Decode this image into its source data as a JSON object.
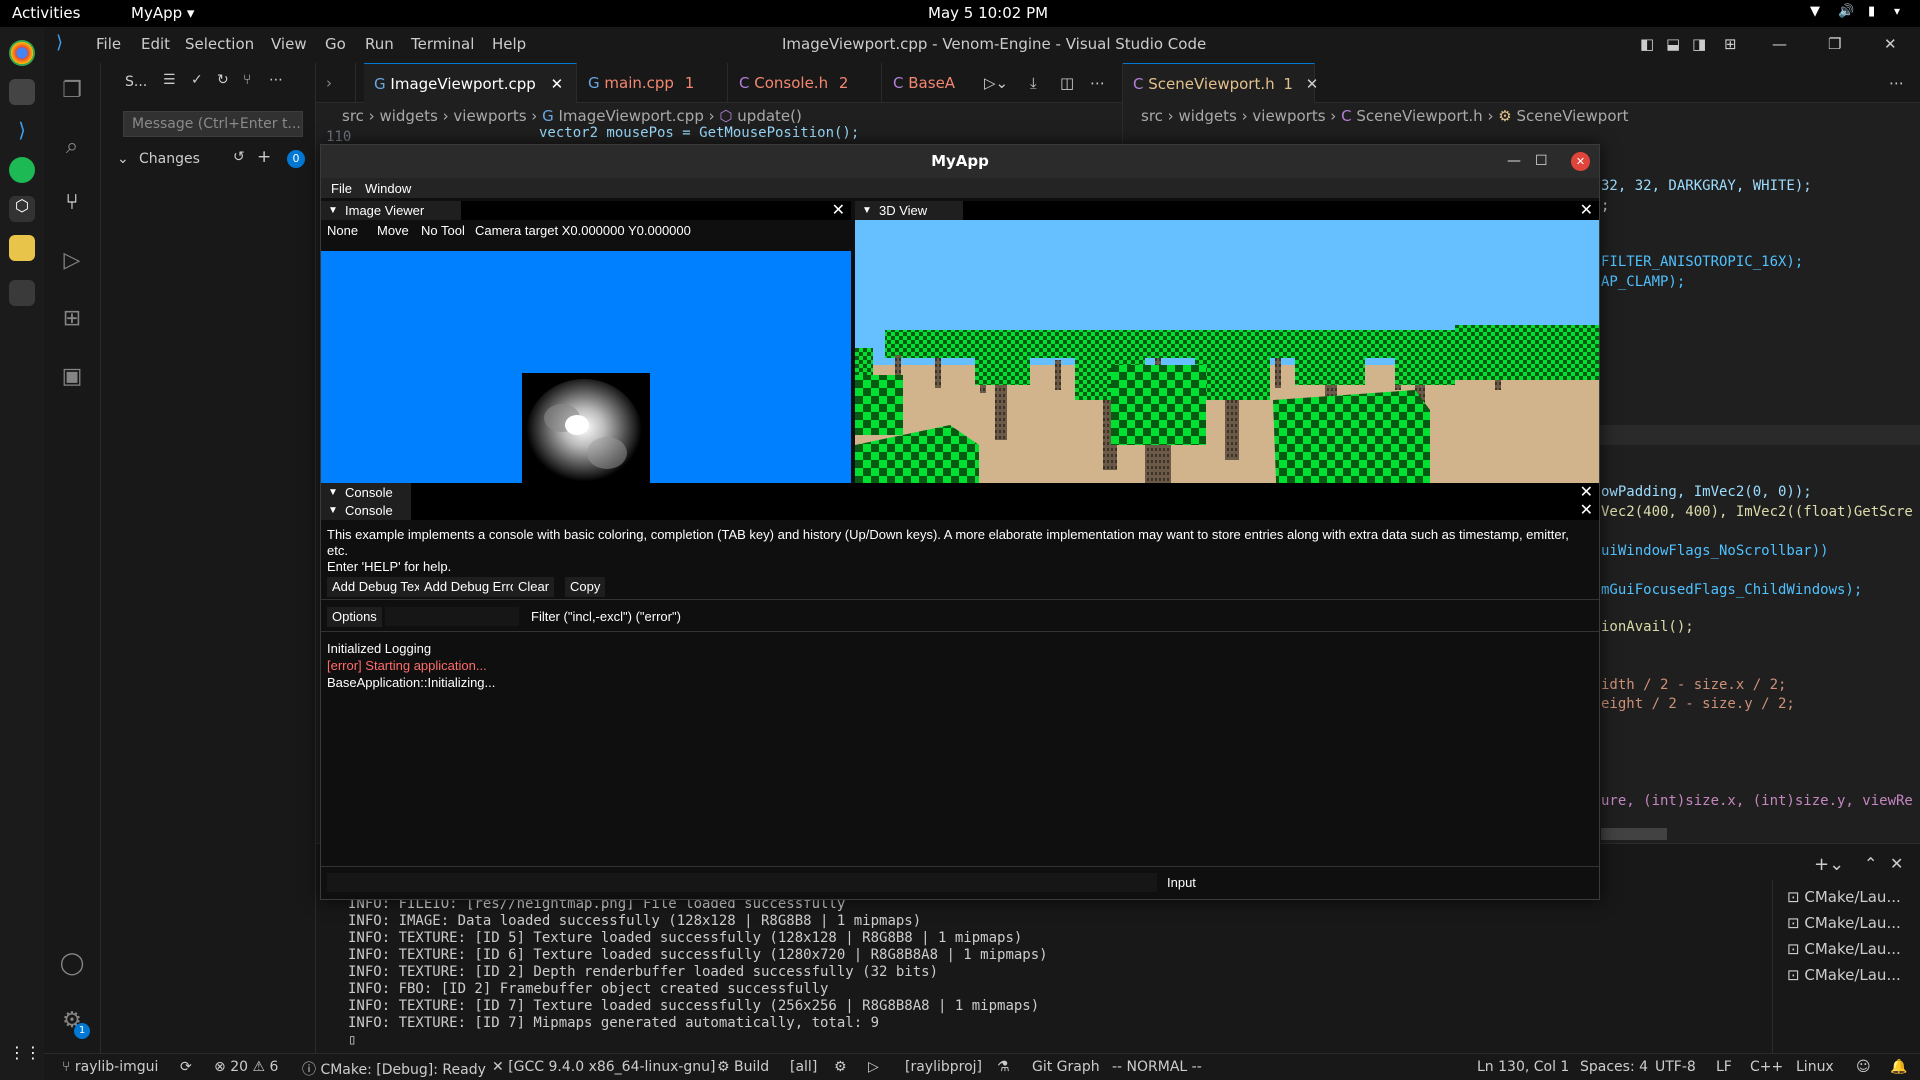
{
  "topbar": {
    "activities": "Activities",
    "app": "MyApp",
    "datetime": "May 5  10:02 PM"
  },
  "vscode": {
    "menu": [
      "File",
      "Edit",
      "Selection",
      "View",
      "Go",
      "Run",
      "Terminal",
      "Help"
    ],
    "title": "ImageViewport.cpp - Venom-Engine - Visual Studio Code",
    "sidebar": {
      "header": "S...",
      "message_placeholder": "Message (Ctrl+Enter t...",
      "changes_label": "Changes",
      "changes_count": "0"
    },
    "tabs_left": [
      {
        "label": "ImageViewport.cpp",
        "badge": "",
        "icon": "G"
      },
      {
        "label": "main.cpp",
        "badge": "1",
        "icon": "G"
      },
      {
        "label": "Console.h",
        "badge": "2",
        "icon": "C"
      },
      {
        "label": "BaseA",
        "badge": "",
        "icon": "C"
      }
    ],
    "tabs_right": [
      {
        "label": "SceneViewport.h",
        "badge": "1",
        "icon": "C"
      }
    ],
    "breadcrumb_left": [
      "src",
      "widgets",
      "viewports",
      "ImageViewport.cpp",
      "update()"
    ],
    "breadcrumb_right": [
      "src",
      "widgets",
      "viewports",
      "SceneViewport.h",
      "SceneViewport"
    ],
    "code_left_partial": "vector2 mousePos = GetMousePosition();",
    "line_no": "110",
    "code_right": [
      "32, 32, DARKGRAY, WHITE);",
      ";",
      "FILTER_ANISOTROPIC_16X);",
      "AP_CLAMP);",
      "owPadding, ImVec2(0, 0));",
      "Vec2(400, 400), ImVec2((float)GetScre",
      "uiWindowFlags_NoScrollbar))",
      "mGuiFocusedFlags_ChildWindows);",
      "ionAvail();",
      "idth / 2 - size.x / 2;",
      "eight / 2 - size.y / 2;",
      "ure, (int)size.x, (int)size.y, viewRe"
    ],
    "terminal_lines": [
      "INFO: FILEIO: [res//heightmap.png] File loaded successfully",
      "INFO: IMAGE: Data loaded successfully (128x128 | R8G8B8 | 1 mipmaps)",
      "INFO: TEXTURE: [ID 5] Texture loaded successfully (128x128 | R8G8B8 | 1 mipmaps)",
      "INFO: TEXTURE: [ID 6] Texture loaded successfully (1280x720 | R8G8B8A8 | 1 mipmaps)",
      "INFO: TEXTURE: [ID 2] Depth renderbuffer loaded successfully (32 bits)",
      "INFO: FBO: [ID 2] Framebuffer object created successfully",
      "INFO: TEXTURE: [ID 7] Texture loaded successfully (256x256 | R8G8B8A8 | 1 mipmaps)",
      "INFO: TEXTURE: [ID 7] Mipmaps generated automatically, total: 9"
    ],
    "terminal_list": [
      "CMake/Lau...",
      "CMake/Lau...",
      "CMake/Lau...",
      "CMake/Lau..."
    ],
    "status": {
      "branch": "raylib-imgui",
      "errors": "20",
      "warnings": "6",
      "cmake": "CMake: [Debug]: Ready",
      "compiler": "[GCC 9.4.0 x86_64-linux-gnu]",
      "build": "Build",
      "target": "[all]",
      "project": "[raylibproj]",
      "gitgraph": "Git Graph",
      "mode": "-- NORMAL --",
      "position": "Ln 130, Col 1",
      "spaces": "Spaces: 4",
      "encoding": "UTF-8",
      "eol": "LF",
      "language": "C++",
      "os": "Linux",
      "settings_badge": "1"
    }
  },
  "myapp": {
    "title": "MyApp",
    "menu": [
      "File",
      "Window"
    ],
    "image_viewer": {
      "tab": "Image Viewer",
      "toolbar": [
        "None",
        "Move",
        "No Tool"
      ],
      "camera": "Camera target X0.000000 Y0.000000"
    },
    "view3d": {
      "tab": "3D View"
    },
    "console": {
      "tab": "Console",
      "description": "This example implements a console with basic coloring, completion (TAB key) and history (Up/Down keys). A more elaborate implementation may want to store entries along with extra data such as timestamp, emitter, etc.",
      "help": "Enter 'HELP' for help.",
      "buttons": [
        "Add Debug Text",
        "Add Debug Error",
        "Clear",
        "Copy"
      ],
      "options": "Options",
      "filter": "Filter (\"incl,-excl\") (\"error\")",
      "log": [
        {
          "text": "Initialized Logging",
          "color": "#ffffff"
        },
        {
          "text": "[error] Starting application...",
          "color": "#ff6b6b"
        },
        {
          "text": "BaseApplication::Initializing...",
          "color": "#ffffff"
        }
      ],
      "input_label": "Input"
    }
  },
  "colors": {
    "accent": "#0078d4",
    "error": "#f48771",
    "image_bg": "#0080ff",
    "sky": "#66bfff",
    "ground": "#d2b48c",
    "tree_green": "#00e030"
  }
}
